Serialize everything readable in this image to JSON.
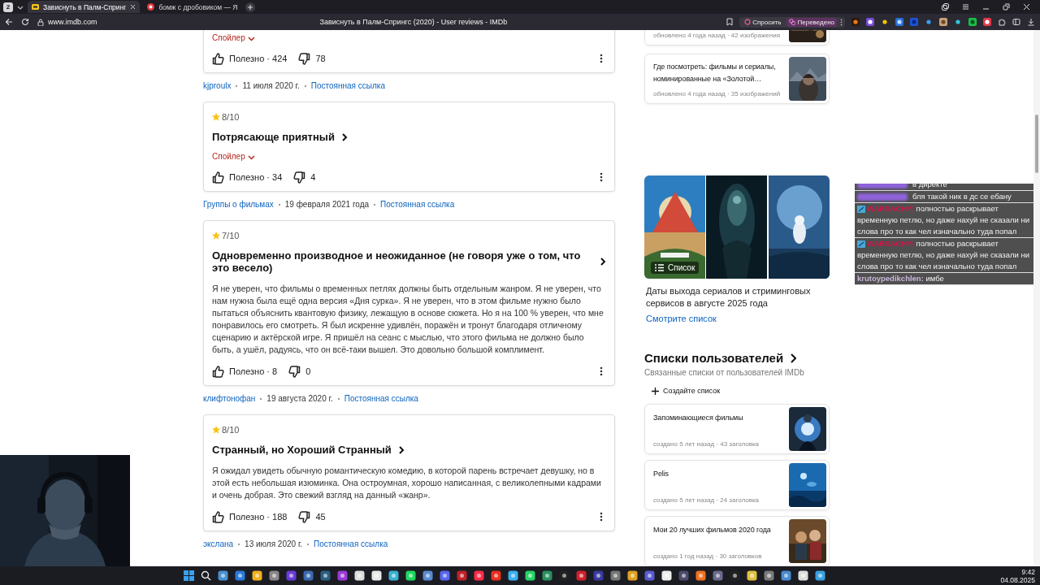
{
  "browser": {
    "tab_count": "2",
    "tabs": [
      {
        "title": "Зависнуть в Палм-Спринг",
        "selected": true,
        "kind": "imdb"
      },
      {
        "title": "бомж с дробовиком — Я",
        "selected": false,
        "kind": "yandex"
      }
    ],
    "url": "www.imdb.com",
    "page_title": "Зависнуть в Палм-Спрингс (2020) - User reviews - IMDb",
    "ask_button": "Спросить",
    "translate_button": "Переведено"
  },
  "reviews": [
    {
      "spoiler": "Спойлер",
      "helpful": "Полезно · 424",
      "unhelpful": "78",
      "meta": [
        "kjproulx",
        "11 июля 2020 г.",
        "Постоянная ссылка"
      ]
    },
    {
      "rating": "8/10",
      "title": "Потрясающе приятный",
      "spoiler": "Спойлер",
      "helpful": "Полезно · 34",
      "unhelpful": "4",
      "meta": [
        "Группы о фильмах",
        "19 февраля 2021 года",
        "Постоянная ссылка"
      ]
    },
    {
      "rating": "7/10",
      "title": "Одновременно производное и неожиданное (не говоря уже о том, что это весело)",
      "body": "Я не уверен, что фильмы о временных петлях должны быть отдельным жанром. Я не уверен, что нам нужна была ещё одна версия «Дня сурка». Я не уверен, что в этом фильме нужно было пытаться объяснить квантовую физику, лежащую в основе сюжета. Но я на 100 % уверен, что мне понравилось его смотреть. Я был искренне удивлён, поражён и тронут благодаря отличному сценарию и актёрской игре. Я пришёл на сеанс с мыслью, что этого фильма не должно было быть, а ушёл, радуясь, что он всё-таки вышел. Это довольно большой комплимент.",
      "helpful": "Полезно · 8",
      "unhelpful": "0",
      "meta": [
        "клифтонофан",
        "19 августа 2020 г.",
        "Постоянная ссылка"
      ]
    },
    {
      "rating": "8/10",
      "title": "Странный, но Хороший Странный",
      "body": "Я ожидал увидеть обычную романтическую комедию, в которой парень встречает девушку, но в этой есть небольшая изюминка. Она остроумная, хорошо написанная, с великолепными кадрами и очень добрая. Это свежий взгляд на данный «жанр».",
      "helpful": "Полезно · 188",
      "unhelpful": "45",
      "meta": [
        "экслана",
        "13 июля 2020 г.",
        "Постоянная ссылка"
      ]
    }
  ],
  "sidebar": {
    "image_lists": [
      {
        "meta": "обновлено 4 года назад · 42 изображения"
      },
      {
        "title": "Где посмотреть: фильмы и сериалы, номинированные на «Золотой…",
        "meta": "обновлено 4 года назад · 35 изображений"
      }
    ],
    "featured": {
      "badge": "Список",
      "title": "Даты выхода сериалов и стриминговых сервисов в августе 2025 года",
      "link": "Смотрите список"
    },
    "user_lists": {
      "heading": "Списки пользователей",
      "subtitle": "Связанные списки от пользователей IMDb",
      "create_button": "Создайте список",
      "items": [
        {
          "title": "Запоминающиеся фильмы",
          "meta": "создано 5 лет назад · 43 заголовка"
        },
        {
          "title": "Pelis",
          "meta": "создано 5 лет назад · 24 заголовка"
        },
        {
          "title": "Мои 20 лучших фильмов 2020 года",
          "meta": "создано 1 год назад · 30 заголовков"
        }
      ]
    }
  },
  "chat": {
    "messages": [
      {
        "color": "#8f63d9",
        "badge": false,
        "text": "в директе"
      },
      {
        "color": "#8f63d9",
        "badge": false,
        "text": "бля такой ник в дс се ебану"
      },
      {
        "user": "WARSACHY:",
        "color": "#d8124a",
        "badge": true,
        "text": "полностью раскрывает временную петлю, но даже нахуй не сказали ни слова про то как чел изначально туда попал"
      },
      {
        "user": "WARSACHY:",
        "color": "#d8124a",
        "badge": true,
        "text": "полностью раскрывает временную петлю, но даже нахуй не сказали ни слова про то как чел изначально туда попал"
      },
      {
        "user": "krutoypedikchlen:",
        "color": "#c8b6d8",
        "badge": false,
        "text": "имбе"
      }
    ]
  },
  "taskbar": {
    "time": "9:42",
    "date": "04.08.2025"
  }
}
